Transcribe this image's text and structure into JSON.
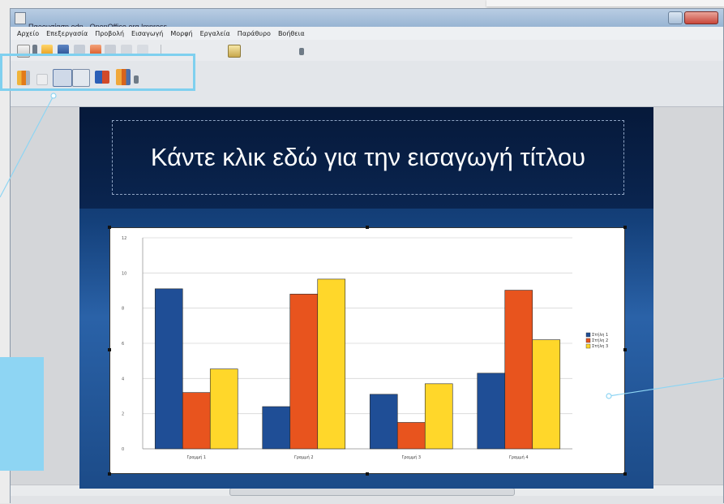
{
  "window": {
    "title": "Παρουσίαση.odp - OpenOffice.org Impress"
  },
  "menu": [
    "Αρχείο",
    "Επεξεργασία",
    "Προβολή",
    "Εισαγωγή",
    "Μορφή",
    "Εργαλεία",
    "Παράθυρο",
    "Βοήθεια"
  ],
  "slide": {
    "title_placeholder": "Κάντε κλικ εδώ για την εισαγωγή τίτλου"
  },
  "colors": {
    "highlight": "#7fd0ef",
    "series1": "#1f4e96",
    "series2": "#e8541e",
    "series3": "#ffd72a"
  },
  "chart_data": {
    "type": "bar",
    "categories": [
      "Γραμμή 1",
      "Γραμμή 2",
      "Γραμμή 3",
      "Γραμμή 4"
    ],
    "series": [
      {
        "name": "Στήλη 1",
        "values": [
          9.1,
          2.4,
          3.1,
          4.3
        ]
      },
      {
        "name": "Στήλη 2",
        "values": [
          3.2,
          8.8,
          1.5,
          9.02
        ]
      },
      {
        "name": "Στήλη 3",
        "values": [
          4.54,
          9.65,
          3.7,
          6.2
        ]
      }
    ],
    "y_ticks": [
      "0",
      "2",
      "4",
      "6",
      "8",
      "10",
      "12"
    ],
    "ylim": [
      0,
      12
    ],
    "grid": true,
    "legend_position": "right"
  }
}
